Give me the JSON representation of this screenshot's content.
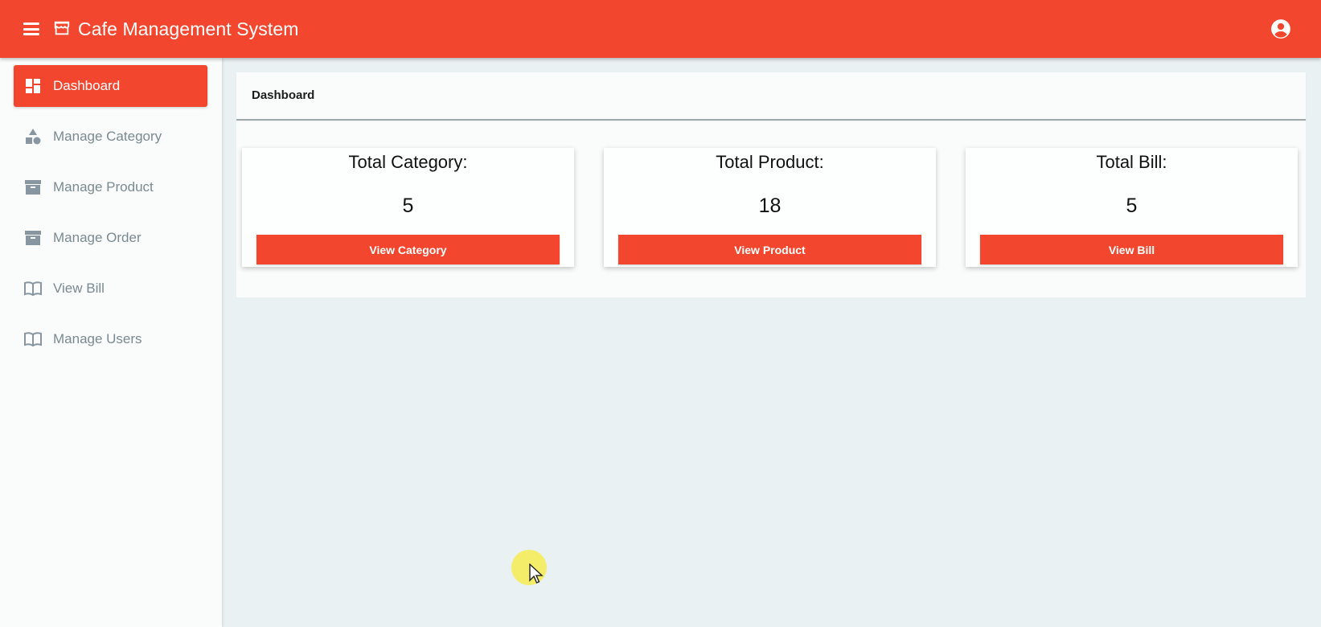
{
  "header": {
    "menu_icon": "menu-icon",
    "store_icon": "storefront-icon",
    "title": "Cafe Management System",
    "account_icon": "account-circle-icon",
    "color": "#f2472e"
  },
  "sidebar": {
    "items": [
      {
        "label": "Dashboard",
        "icon": "dashboard-icon",
        "active": true
      },
      {
        "label": "Manage Category",
        "icon": "category-icon",
        "active": false
      },
      {
        "label": "Manage Product",
        "icon": "inventory-icon",
        "active": false
      },
      {
        "label": "Manage Order",
        "icon": "inventory-icon",
        "active": false
      },
      {
        "label": "View Bill",
        "icon": "book-icon",
        "active": false
      },
      {
        "label": "Manage Users",
        "icon": "book-icon",
        "active": false
      }
    ]
  },
  "main": {
    "title": "Dashboard",
    "stats": [
      {
        "label": "Total Category:",
        "value": "5",
        "button": "View Category"
      },
      {
        "label": "Total Product:",
        "value": "18",
        "button": "View Product"
      },
      {
        "label": "Total Bill:",
        "value": "5",
        "button": "View Bill"
      }
    ]
  }
}
